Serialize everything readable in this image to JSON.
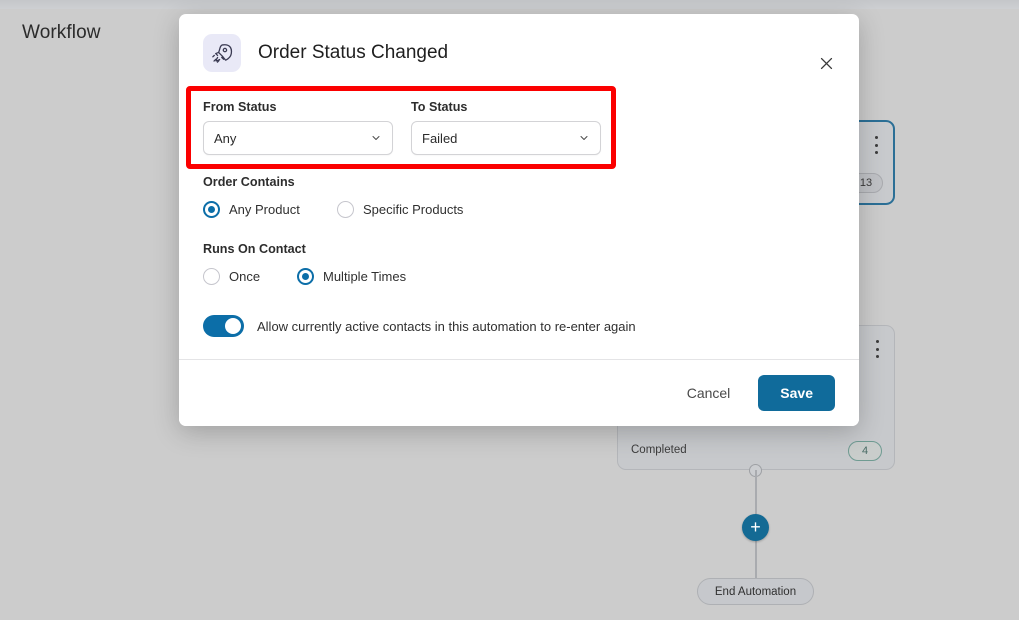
{
  "page": {
    "title": "Workflow",
    "background_color": "#cccccc"
  },
  "workflow_canvas": {
    "top_card": {
      "kebab_icon": "kebab-menu-icon",
      "badge_count": "13",
      "selected": true,
      "selected_border_color": "#2b6f96"
    },
    "bottom_card": {
      "kebab_icon": "kebab-menu-icon",
      "row_label": "Completed",
      "badge_count": "4",
      "badge_border_color": "#6f9b92"
    },
    "add_button": {
      "icon": "plus-icon",
      "label": "+",
      "color": "#146a94"
    },
    "end_node": {
      "label": "End Automation"
    }
  },
  "modal": {
    "icon": "rocket-icon",
    "title": "Order Status Changed",
    "close_icon": "close-icon",
    "fields": {
      "from_status": {
        "label": "From Status",
        "value": "Any",
        "chevron_icon": "chevron-down-icon",
        "options": [
          "Any"
        ]
      },
      "to_status": {
        "label": "To Status",
        "value": "Failed",
        "chevron_icon": "chevron-down-icon",
        "options": [
          "Failed"
        ]
      }
    },
    "order_contains": {
      "label": "Order Contains",
      "options": [
        {
          "label": "Any Product",
          "selected": true
        },
        {
          "label": "Specific Products",
          "selected": false
        }
      ]
    },
    "runs_on_contact": {
      "label": "Runs On Contact",
      "options": [
        {
          "label": "Once",
          "selected": false
        },
        {
          "label": "Multiple Times",
          "selected": true
        }
      ]
    },
    "reenter_toggle": {
      "label": "Allow currently active contacts in this automation to re-enter again",
      "enabled": true,
      "on_color": "#0c6ea8"
    },
    "footer": {
      "cancel_label": "Cancel",
      "save_label": "Save",
      "save_color": "#106b9b"
    }
  },
  "annotation": {
    "highlight_color": "#fb0000",
    "target": "from-status and to-status fields"
  }
}
